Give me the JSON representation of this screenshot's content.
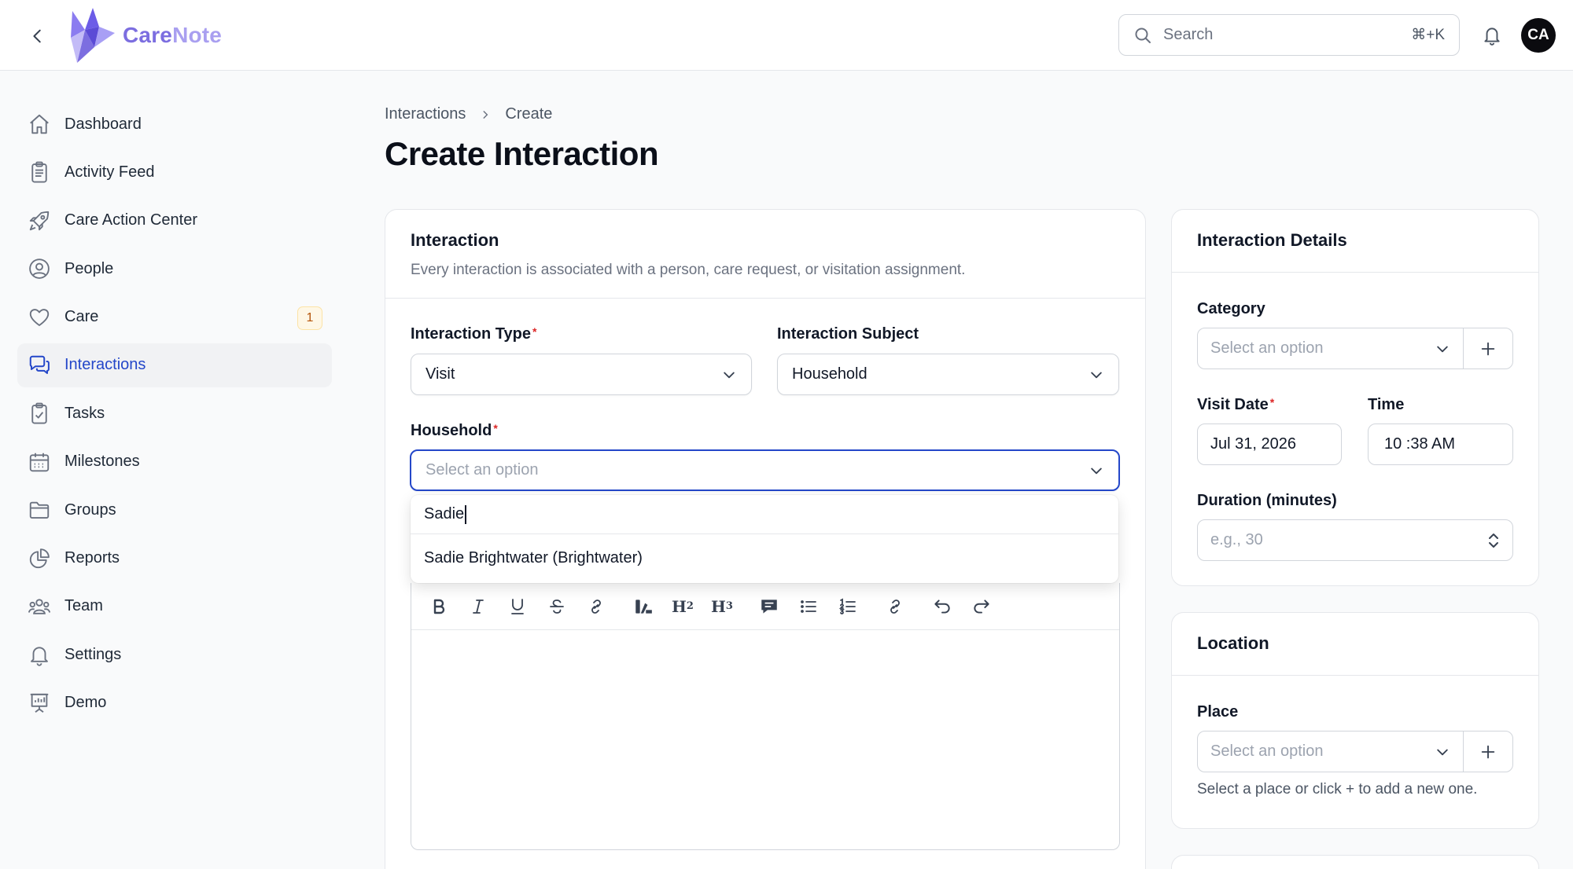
{
  "app": {
    "brand_part1": "Care",
    "brand_part2": "Note",
    "accent_color": "#2447c9",
    "brand_color": "#7c6ee0"
  },
  "topbar": {
    "search_placeholder": "Search",
    "search_shortcut": "⌘+K",
    "avatar_initials": "CA"
  },
  "sidebar": {
    "items": [
      {
        "label": "Dashboard",
        "icon": "home-icon"
      },
      {
        "label": "Activity Feed",
        "icon": "clipboard-icon"
      },
      {
        "label": "Care Action Center",
        "icon": "rocket-icon"
      },
      {
        "label": "People",
        "icon": "user-circle-icon"
      },
      {
        "label": "Care",
        "icon": "heart-icon",
        "badge": "1"
      },
      {
        "label": "Interactions",
        "icon": "chat-bubbles-icon",
        "active": true
      },
      {
        "label": "Tasks",
        "icon": "clipboard-check-icon"
      },
      {
        "label": "Milestones",
        "icon": "calendar-icon"
      },
      {
        "label": "Groups",
        "icon": "folder-icon"
      },
      {
        "label": "Reports",
        "icon": "pie-chart-icon"
      },
      {
        "label": "Team",
        "icon": "user-group-icon"
      },
      {
        "label": "Settings",
        "icon": "bell-settings-icon"
      },
      {
        "label": "Demo",
        "icon": "presentation-icon"
      }
    ]
  },
  "breadcrumb": {
    "parent": "Interactions",
    "current": "Create"
  },
  "page_title": "Create Interaction",
  "interaction_card": {
    "title": "Interaction",
    "description": "Every interaction is associated with a person, care request, or visitation assignment.",
    "type_label": "Interaction Type",
    "type_value": "Visit",
    "subject_label": "Interaction Subject",
    "subject_value": "Household",
    "household_label": "Household",
    "household_placeholder": "Select an option",
    "dropdown": {
      "search_text": "Sadie",
      "options": [
        "Sadie Brightwater (Brightwater)"
      ]
    }
  },
  "details_card": {
    "title": "Interaction Details",
    "category_label": "Category",
    "category_placeholder": "Select an option",
    "visit_date_label": "Visit Date",
    "visit_date_value": "Jul 31, 2026",
    "time_label": "Time",
    "time_value": "10 :38 AM",
    "duration_label": "Duration (minutes)",
    "duration_placeholder": "e.g., 30"
  },
  "location_card": {
    "title": "Location",
    "place_label": "Place",
    "place_placeholder": "Select an option",
    "place_hint": "Select a place or click + to add a new one."
  }
}
